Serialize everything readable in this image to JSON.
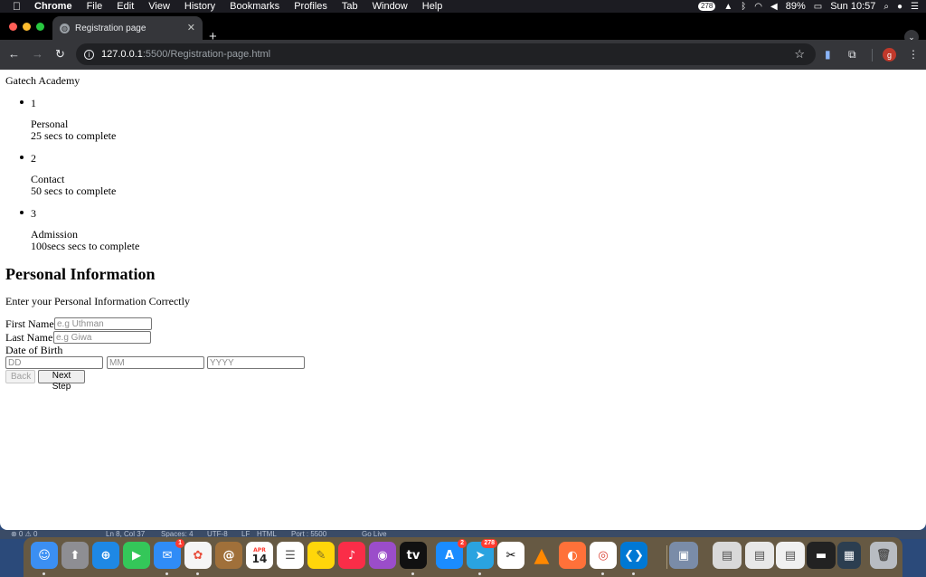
{
  "menubar": {
    "app_name": "Chrome",
    "items": [
      "File",
      "Edit",
      "View",
      "History",
      "Bookmarks",
      "Profiles",
      "Tab",
      "Window",
      "Help"
    ],
    "status": {
      "badge": "278",
      "battery": "89%",
      "clock": "Sun 10:57"
    }
  },
  "browser": {
    "tab_title": "Registration page",
    "url_host": "127.0.0.1",
    "url_path": ":5500/Registration-page.html",
    "profile_initial": "g"
  },
  "page": {
    "brand": "Gatech Academy",
    "steps": [
      {
        "number": "1",
        "title": "Personal",
        "time": "25 secs to complete"
      },
      {
        "number": "2",
        "title": "Contact",
        "time": "50 secs to complete"
      },
      {
        "number": "3",
        "title": "Admission",
        "time": "100secs secs to complete"
      }
    ],
    "heading": "Personal Information",
    "subtitle": "Enter your Personal Information Correctly",
    "form": {
      "first_name_label": "First Name",
      "first_name_placeholder": "e.g Uthman",
      "last_name_label": "Last Name",
      "last_name_placeholder": "e.g Giwa",
      "dob_label": "Date of Birth",
      "dd_placeholder": "DD",
      "mm_placeholder": "MM",
      "yyyy_placeholder": "YYYY",
      "back_label": "Back",
      "next_label": "Next Step"
    }
  },
  "vscode_status": {
    "problems": "⊗ 0 ⚠ 0",
    "cursor": "Ln 8, Col 37",
    "spaces": "Spaces: 4",
    "encoding": "UTF-8",
    "eol": "LF",
    "language": "HTML",
    "port": "Port : 5500",
    "golive": "Go Live"
  },
  "dock": {
    "messages_badge": "1",
    "calendar_month": "APR",
    "calendar_day": "14",
    "appstore_badge": "2",
    "telegram_badge": "278"
  }
}
